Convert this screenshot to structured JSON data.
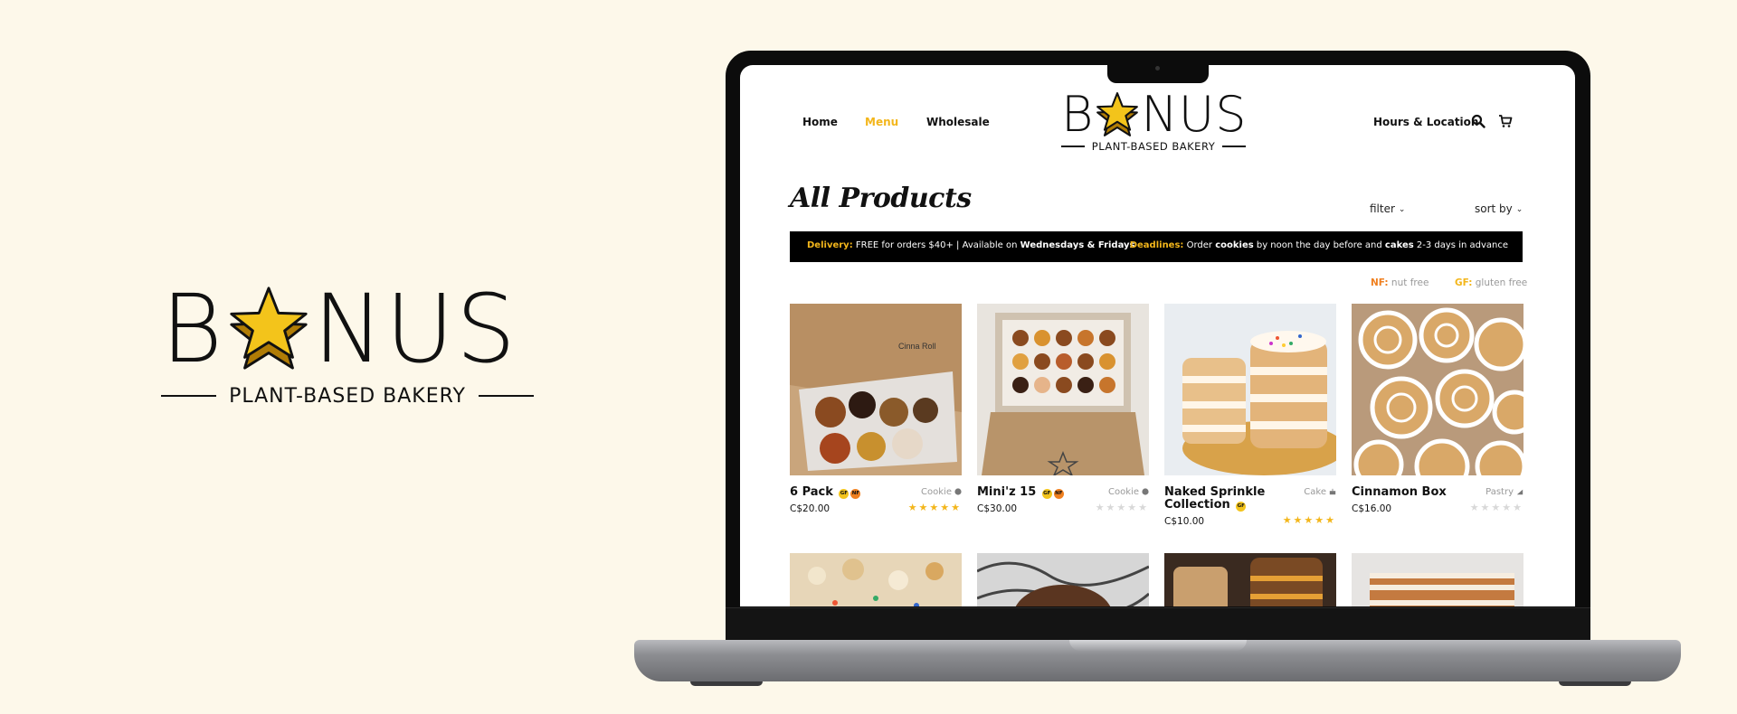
{
  "brand": {
    "word_left": "B",
    "word_right": "NUS",
    "tagline": "PLANT-BASED BAKERY",
    "colors": {
      "accent": "#f3b61b",
      "background": "#fdf8ea",
      "ink": "#111111"
    }
  },
  "nav": {
    "items": [
      {
        "label": "Home",
        "active": false
      },
      {
        "label": "Menu",
        "active": true
      },
      {
        "label": "Wholesale",
        "active": false
      }
    ],
    "right_link": "Hours & Location",
    "icons": [
      "search-icon",
      "cart-icon"
    ]
  },
  "page": {
    "title": "All Products",
    "filter_label": "filter",
    "sort_label": "sort by"
  },
  "banner": {
    "delivery_label": "Delivery:",
    "delivery_text_1": " FREE for orders $40+ | Available on ",
    "delivery_days": "Wednesdays & Fridays",
    "deadlines_label": "Deadlines:",
    "deadlines_text_1": " Order ",
    "deadlines_cookies": "cookies",
    "deadlines_text_2": " by noon the day before and ",
    "deadlines_cakes": "cakes",
    "deadlines_text_3": " 2-3 days in advance"
  },
  "legend": {
    "nf_key": "NF:",
    "nf_text": " nut free",
    "gf_key": "GF:",
    "gf_text": " gluten free"
  },
  "products": [
    {
      "name": "6 Pack",
      "badges": [
        "GF",
        "NF"
      ],
      "category": "Cookie",
      "category_icon": "cookie-icon",
      "price": "C$20.00",
      "rating": 5
    },
    {
      "name": "Mini'z 15",
      "badges": [
        "GF",
        "NF"
      ],
      "category": "Cookie",
      "category_icon": "cookie-icon",
      "price": "C$30.00",
      "rating": 0
    },
    {
      "name": "Naked Sprinkle Collection",
      "badges": [
        "GF"
      ],
      "category": "Cake",
      "category_icon": "cake-icon",
      "price": "C$10.00",
      "rating": 5
    },
    {
      "name": "Cinnamon Box",
      "badges": [],
      "category": "Pastry",
      "category_icon": "pastry-icon",
      "price": "C$16.00",
      "rating": 0
    }
  ]
}
